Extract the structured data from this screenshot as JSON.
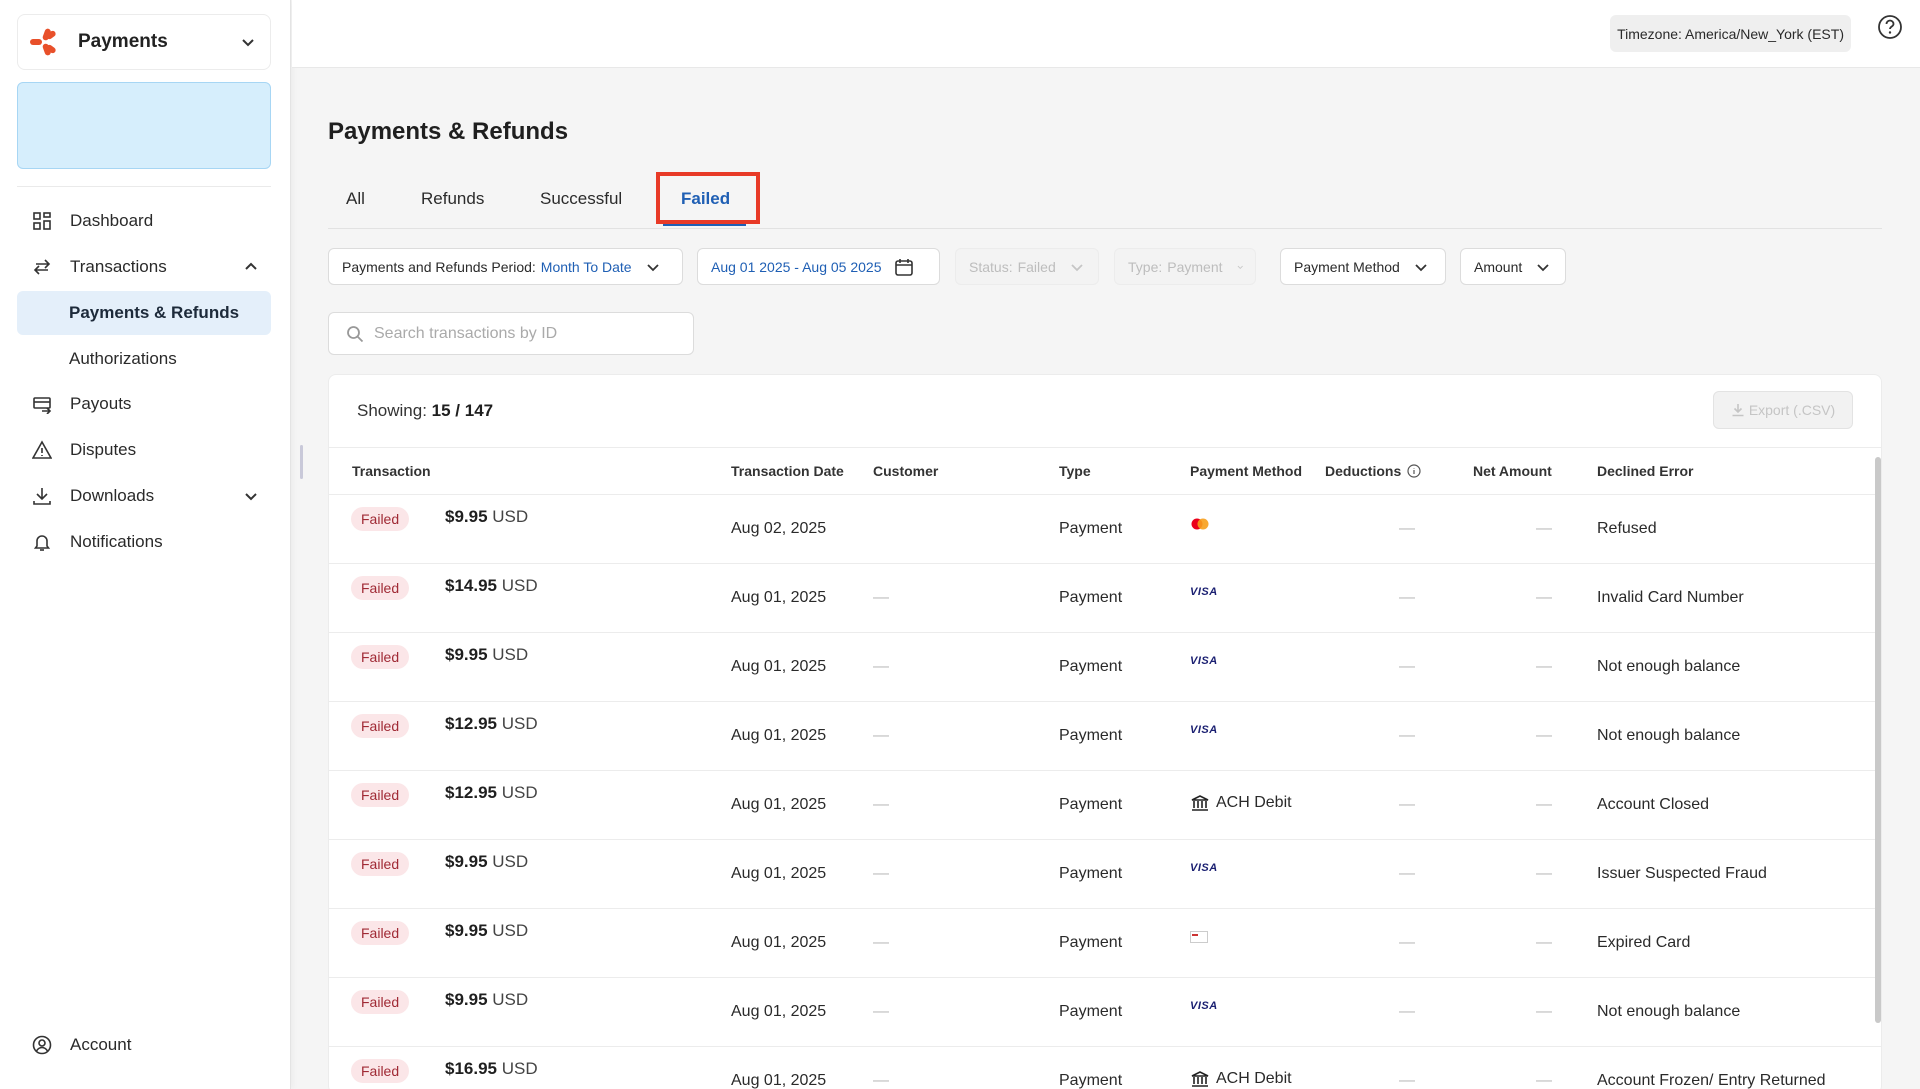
{
  "sidebar": {
    "app_name": "Payments",
    "nav": {
      "dashboard": "Dashboard",
      "transactions": "Transactions",
      "payments_refunds": "Payments & Refunds",
      "authorizations": "Authorizations",
      "payouts": "Payouts",
      "disputes": "Disputes",
      "downloads": "Downloads",
      "notifications": "Notifications",
      "account": "Account"
    }
  },
  "topbar": {
    "timezone": "Timezone: America/New_York (EST)"
  },
  "page": {
    "title": "Payments & Refunds"
  },
  "tabs": {
    "all": "All",
    "refunds": "Refunds",
    "successful": "Successful",
    "failed": "Failed"
  },
  "filters": {
    "period_label": "Payments and Refunds Period:",
    "period_value": "Month To Date",
    "date_range": "Aug 01 2025 - Aug 05 2025",
    "status_label": "Status:",
    "status_value": "Failed",
    "type_label": "Type:",
    "type_value": "Payment",
    "payment_method": "Payment Method",
    "amount": "Amount"
  },
  "search": {
    "placeholder": "Search transactions by ID"
  },
  "table": {
    "showing_label": "Showing:",
    "showing_value": "15 / 147",
    "export_label": "Export (.CSV)",
    "headers": {
      "transaction": "Transaction",
      "date": "Transaction Date",
      "customer": "Customer",
      "type": "Type",
      "method": "Payment Method",
      "deductions": "Deductions",
      "net": "Net Amount",
      "error": "Declined Error"
    },
    "rows": [
      {
        "status": "Failed",
        "amount": "$9.95",
        "currency": "USD",
        "date": "Aug 02, 2025",
        "customer": "",
        "type": "Payment",
        "method": "mastercard",
        "method_label": "",
        "deductions": "—",
        "net": "—",
        "error": "Refused"
      },
      {
        "status": "Failed",
        "amount": "$14.95",
        "currency": "USD",
        "date": "Aug 01, 2025",
        "customer": "—",
        "type": "Payment",
        "method": "visa",
        "method_label": "VISA",
        "deductions": "—",
        "net": "—",
        "error": "Invalid Card Number"
      },
      {
        "status": "Failed",
        "amount": "$9.95",
        "currency": "USD",
        "date": "Aug 01, 2025",
        "customer": "—",
        "type": "Payment",
        "method": "visa",
        "method_label": "VISA",
        "deductions": "—",
        "net": "—",
        "error": "Not enough balance"
      },
      {
        "status": "Failed",
        "amount": "$12.95",
        "currency": "USD",
        "date": "Aug 01, 2025",
        "customer": "—",
        "type": "Payment",
        "method": "visa",
        "method_label": "VISA",
        "deductions": "—",
        "net": "—",
        "error": "Not enough balance"
      },
      {
        "status": "Failed",
        "amount": "$12.95",
        "currency": "USD",
        "date": "Aug 01, 2025",
        "customer": "—",
        "type": "Payment",
        "method": "bank",
        "method_label": "ACH Debit",
        "deductions": "—",
        "net": "—",
        "error": "Account Closed"
      },
      {
        "status": "Failed",
        "amount": "$9.95",
        "currency": "USD",
        "date": "Aug 01, 2025",
        "customer": "—",
        "type": "Payment",
        "method": "visa",
        "method_label": "VISA",
        "deductions": "—",
        "net": "—",
        "error": "Issuer Suspected Fraud"
      },
      {
        "status": "Failed",
        "amount": "$9.95",
        "currency": "USD",
        "date": "Aug 01, 2025",
        "customer": "—",
        "type": "Payment",
        "method": "generic-card",
        "method_label": "",
        "deductions": "—",
        "net": "—",
        "error": "Expired Card"
      },
      {
        "status": "Failed",
        "amount": "$9.95",
        "currency": "USD",
        "date": "Aug 01, 2025",
        "customer": "—",
        "type": "Payment",
        "method": "visa",
        "method_label": "VISA",
        "deductions": "—",
        "net": "—",
        "error": "Not enough balance"
      },
      {
        "status": "Failed",
        "amount": "$16.95",
        "currency": "USD",
        "date": "Aug 01, 2025",
        "customer": "—",
        "type": "Payment",
        "method": "bank",
        "method_label": "ACH Debit",
        "deductions": "—",
        "net": "—",
        "error": "Account Frozen/ Entry Returned"
      }
    ]
  },
  "colors": {
    "accent": "#1f5fb4",
    "highlight": "#e83a27",
    "failed_bg": "#fbe6e8",
    "failed_text": "#a02a35",
    "banner": "#d6eefc"
  }
}
